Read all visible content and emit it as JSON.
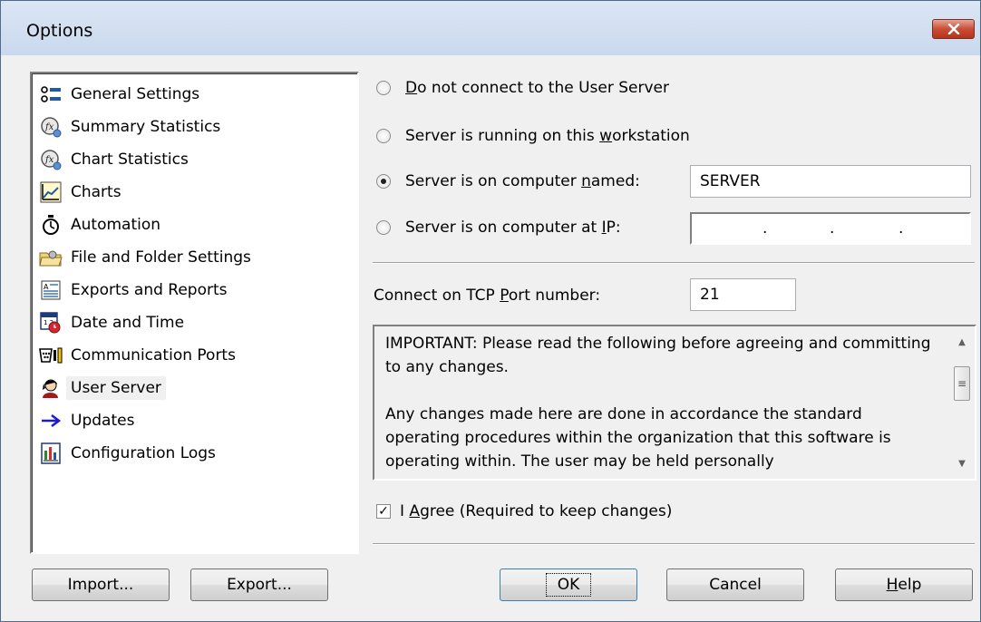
{
  "window": {
    "title": "Options"
  },
  "nav": {
    "items": [
      {
        "label": "General Settings",
        "icon": "general-settings-icon"
      },
      {
        "label": "Summary Statistics",
        "icon": "summary-statistics-icon"
      },
      {
        "label": "Chart Statistics",
        "icon": "chart-statistics-icon"
      },
      {
        "label": "Charts",
        "icon": "charts-icon"
      },
      {
        "label": "Automation",
        "icon": "stopwatch-icon"
      },
      {
        "label": "File and Folder Settings",
        "icon": "folder-icon"
      },
      {
        "label": "Exports and Reports",
        "icon": "report-icon"
      },
      {
        "label": "Date and Time",
        "icon": "calendar-clock-icon"
      },
      {
        "label": "Communication Ports",
        "icon": "ports-icon"
      },
      {
        "label": "User Server",
        "icon": "user-icon",
        "selected": true
      },
      {
        "label": "Updates",
        "icon": "arrow-right-icon"
      },
      {
        "label": "Configuration Logs",
        "icon": "log-icon"
      }
    ]
  },
  "server": {
    "options": [
      {
        "pre": "",
        "key": "D",
        "post": "o not connect to the User Server",
        "selected": false
      },
      {
        "pre": "Server is running on this ",
        "key": "w",
        "post": "orkstation",
        "selected": false
      },
      {
        "pre": "Server is on computer ",
        "key": "n",
        "post": "amed:",
        "selected": true
      },
      {
        "pre": "Server is on computer at ",
        "key": "I",
        "post": "P:",
        "selected": false
      }
    ],
    "computer_name": "SERVER",
    "ip_dots": [
      ".",
      ".",
      "."
    ],
    "port_label_pre": "Connect on TCP ",
    "port_label_key": "P",
    "port_label_post": "ort number:",
    "port": "21"
  },
  "notice": {
    "para1": "IMPORTANT: Please read the following before agreeing and committing to any changes.",
    "para2": "Any changes made here are done in accordance the standard operating procedures within the organization that this software is operating within. The user may be held personally"
  },
  "agree": {
    "pre": "I ",
    "key": "A",
    "post": "gree (Required to keep changes)",
    "checked": true
  },
  "buttons": {
    "import": "Import...",
    "export": "Export...",
    "ok": "OK",
    "cancel": "Cancel",
    "help_key": "H",
    "help_rest": "elp"
  }
}
